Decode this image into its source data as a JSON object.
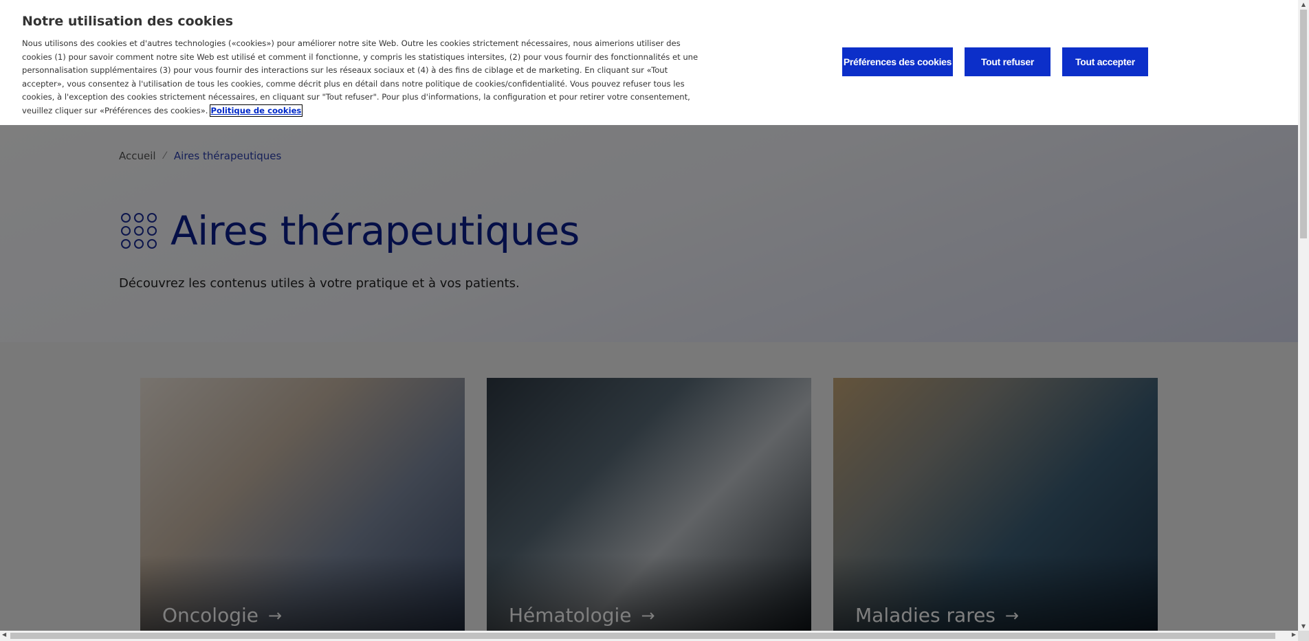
{
  "cookie_banner": {
    "title": "Notre utilisation des cookies",
    "text": "Nous utilisons des cookies et d'autres technologies («cookies») pour améliorer notre site Web. Outre les cookies strictement nécessaires, nous aimerions utiliser des cookies (1) pour savoir comment notre site Web est utilisé et comment il fonctionne, y compris les statistiques intersites, (2) pour vous fournir des fonctionnalités et une personnalisation supplémentaires (3) pour vous fournir des interactions sur les réseaux sociaux et (4) à des fins de ciblage et de marketing. En cliquant sur «Tout accepter», vous consentez à l'utilisation de tous les cookies, comme décrit plus en détail dans notre politique de cookies/confidentialité. Vous pouvez refuser tous les cookies, à l'exception des cookies strictement nécessaires, en cliquant sur \"Tout refuser\". Pour plus d'informations, la configuration et pour retirer votre consentement, veuillez cliquer sur «Préférences des cookies».",
    "policy_link": "Politique de cookies",
    "buttons": {
      "preferences": "Préférences des cookies",
      "refuse": "Tout refuser",
      "accept": "Tout accepter"
    }
  },
  "breadcrumb": {
    "home": "Accueil",
    "separator": "⁄",
    "current": "Aires thérapeutiques"
  },
  "page": {
    "title": "Aires thérapeutiques",
    "subtitle": "Découvrez les contenus utiles à votre pratique et à vos patients."
  },
  "cards": [
    {
      "label": "Oncologie",
      "arrow": "→"
    },
    {
      "label": "Hématologie",
      "arrow": "→"
    },
    {
      "label": "Maladies rares",
      "arrow": "→"
    }
  ],
  "colors": {
    "brand_blue": "#0c2fc9",
    "title_blue": "#0b1f8f"
  },
  "scrollbar": {
    "up": "▲",
    "down": "▼",
    "left": "◀",
    "right": "▶"
  }
}
